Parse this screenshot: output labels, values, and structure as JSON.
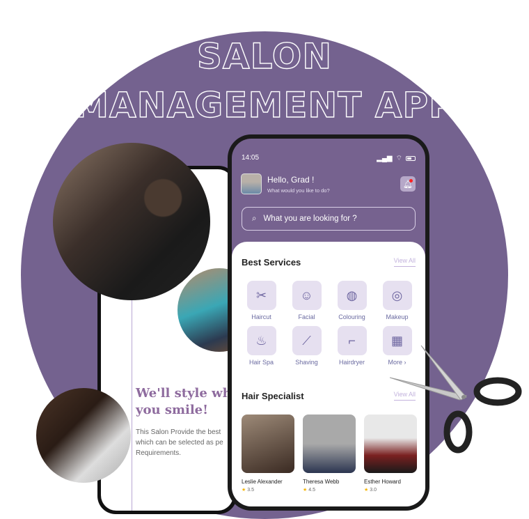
{
  "headline": {
    "line1": "SALON",
    "line2": "MANAGEMENT APP"
  },
  "left_phone": {
    "heading_line1": "We'll style while",
    "heading_line2": "you smile!",
    "body_line1": "This Salon Provide the best",
    "body_line2": "which can be selected as pe",
    "body_line3": "Requirements."
  },
  "app": {
    "status_time": "14:05",
    "greeting": "Hello, Grad !",
    "subtitle": "What would you like to do?",
    "search_placeholder": "What you are looking for ?",
    "best_services": {
      "title": "Best Services",
      "view_all": "View All",
      "items": [
        {
          "label": "Haircut",
          "icon": "✂"
        },
        {
          "label": "Facial",
          "icon": "☺"
        },
        {
          "label": "Colouring",
          "icon": "◍"
        },
        {
          "label": "Makeup",
          "icon": "◎"
        },
        {
          "label": "Hair Spa",
          "icon": "♨"
        },
        {
          "label": "Shaving",
          "icon": "⟋"
        },
        {
          "label": "Hairdryer",
          "icon": "⌐"
        },
        {
          "label": "More ›",
          "icon": "▦"
        }
      ]
    },
    "hair_specialist": {
      "title": "Hair Specialist",
      "view_all": "View All",
      "items": [
        {
          "name": "Leslie Alexander",
          "rating": "3.5"
        },
        {
          "name": "Theresa Webb",
          "rating": "4.5"
        },
        {
          "name": "Esther Howard",
          "rating": "3.0"
        }
      ]
    }
  },
  "colors": {
    "brand": "#74628f",
    "accent_light": "#e6e0f0"
  }
}
